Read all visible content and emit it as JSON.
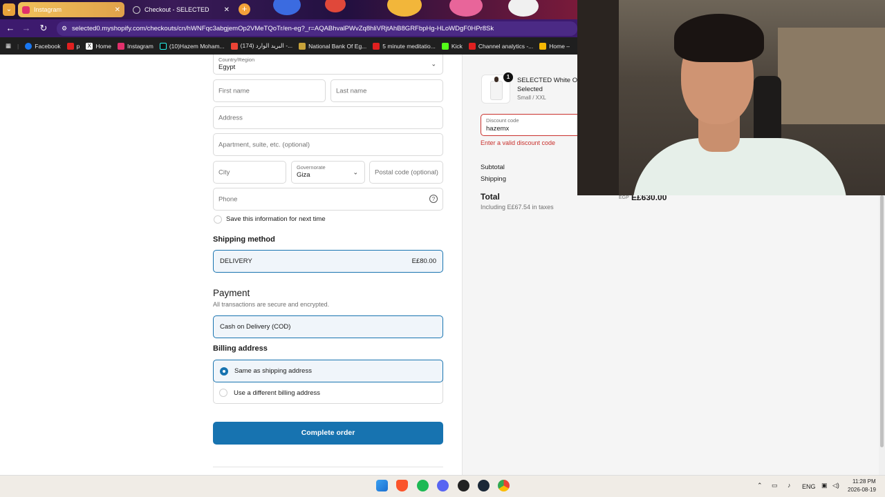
{
  "browser": {
    "tabs": [
      {
        "label": "Instagram",
        "active": false
      },
      {
        "label": "Checkout - SELECTED",
        "active": true
      }
    ],
    "url": "selected0.myshopify.com/checkouts/cn/hWNFqc3abgjemOp2VMeTQoTr/en-eg?_r=AQABhvalPWvZq8hliVRjtAhB8GRFbpHg-HLoWDgF0HPr8Sk",
    "bookmarks": [
      "Facebook",
      "p",
      "Home",
      "Instagram",
      "(10)Hazem Moham...",
      "",
      "(174) البريد الوارد -...",
      "National Bank Of Eg...",
      "5 minute meditatio...",
      "Kick",
      "Channel analytics -...",
      "Home –"
    ]
  },
  "form": {
    "country_label": "Country/Region",
    "country_value": "Egypt",
    "first_name_ph": "First name",
    "last_name_ph": "Last name",
    "address_ph": "Address",
    "apt_ph": "Apartment, suite, etc. (optional)",
    "city_ph": "City",
    "gov_label": "Governorate",
    "gov_value": "Giza",
    "postal_ph": "Postal code (optional)",
    "phone_ph": "Phone",
    "save_info": "Save this information for next time"
  },
  "shipping": {
    "title": "Shipping method",
    "method": "DELIVERY",
    "price": "E£80.00"
  },
  "payment": {
    "title": "Payment",
    "subtitle": "All transactions are secure and encrypted.",
    "method": "Cash on Delivery (COD)"
  },
  "billing": {
    "title": "Billing address",
    "opt1": "Same as shipping address",
    "opt2": "Use a different billing address"
  },
  "complete_label": "Complete order",
  "summary": {
    "qty": "1",
    "product_name": "SELECTED White Ove",
    "product_name2": "Selected",
    "variant": "Small / XXL",
    "discount_label": "Discount code",
    "discount_value": "hazemx",
    "discount_error": "Enter a valid discount code",
    "subtotal_label": "Subtotal",
    "shipping_label": "Shipping",
    "total_label": "Total",
    "currency": "EGP",
    "total_value": "E£630.00",
    "taxes_note": "Including E£67.54 in taxes"
  },
  "taskbar": {
    "lang": "ENG",
    "time": "11:28 PM",
    "date": "2026-08-19"
  }
}
